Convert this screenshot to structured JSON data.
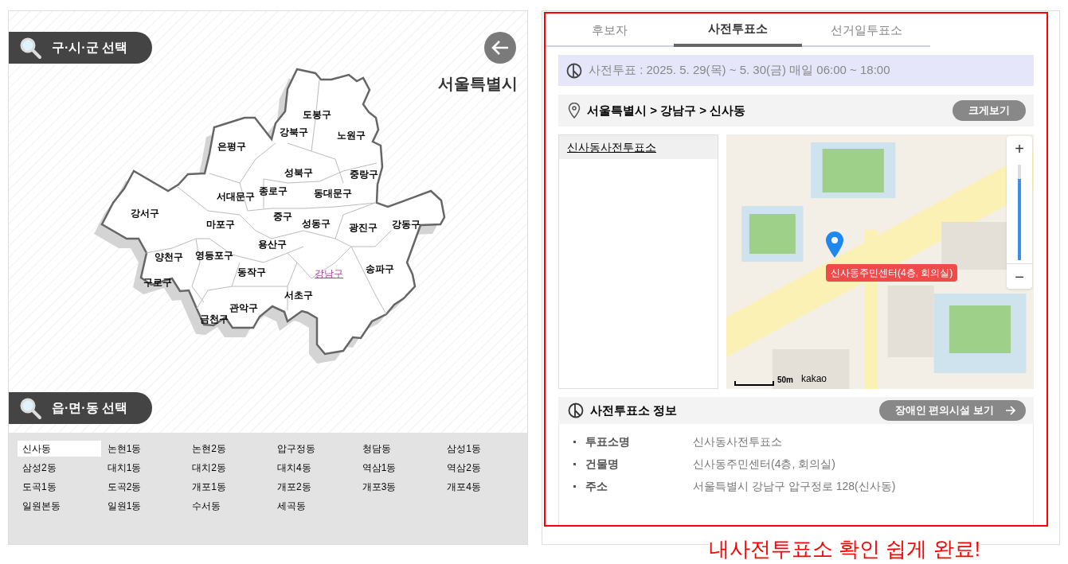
{
  "district_panel": {
    "header": "구·시·군 선택",
    "city": "서울특별시",
    "districts": [
      {
        "name": "도봉구",
        "selected": false
      },
      {
        "name": "강북구",
        "selected": false
      },
      {
        "name": "노원구",
        "selected": false
      },
      {
        "name": "은평구",
        "selected": false
      },
      {
        "name": "성북구",
        "selected": false
      },
      {
        "name": "중랑구",
        "selected": false
      },
      {
        "name": "종로구",
        "selected": false
      },
      {
        "name": "서대문구",
        "selected": false
      },
      {
        "name": "동대문구",
        "selected": false
      },
      {
        "name": "강서구",
        "selected": false
      },
      {
        "name": "마포구",
        "selected": false
      },
      {
        "name": "중구",
        "selected": false
      },
      {
        "name": "성동구",
        "selected": false
      },
      {
        "name": "광진구",
        "selected": false
      },
      {
        "name": "강동구",
        "selected": false
      },
      {
        "name": "용산구",
        "selected": false
      },
      {
        "name": "양천구",
        "selected": false
      },
      {
        "name": "영등포구",
        "selected": false
      },
      {
        "name": "동작구",
        "selected": false
      },
      {
        "name": "강남구",
        "selected": true
      },
      {
        "name": "송파구",
        "selected": false
      },
      {
        "name": "구로구",
        "selected": false
      },
      {
        "name": "서초구",
        "selected": false
      },
      {
        "name": "관악구",
        "selected": false
      },
      {
        "name": "금천구",
        "selected": false
      }
    ]
  },
  "dong_panel": {
    "header": "읍·면·동 선택",
    "dongs": [
      {
        "name": "신사동",
        "selected": true
      },
      {
        "name": "논현1동",
        "selected": false
      },
      {
        "name": "논현2동",
        "selected": false
      },
      {
        "name": "압구정동",
        "selected": false
      },
      {
        "name": "청담동",
        "selected": false
      },
      {
        "name": "삼성1동",
        "selected": false
      },
      {
        "name": "삼성2동",
        "selected": false
      },
      {
        "name": "대치1동",
        "selected": false
      },
      {
        "name": "대치2동",
        "selected": false
      },
      {
        "name": "대치4동",
        "selected": false
      },
      {
        "name": "역삼1동",
        "selected": false
      },
      {
        "name": "역삼2동",
        "selected": false
      },
      {
        "name": "도곡1동",
        "selected": false
      },
      {
        "name": "도곡2동",
        "selected": false
      },
      {
        "name": "개포1동",
        "selected": false
      },
      {
        "name": "개포2동",
        "selected": false
      },
      {
        "name": "개포3동",
        "selected": false
      },
      {
        "name": "개포4동",
        "selected": false
      },
      {
        "name": "일원본동",
        "selected": false
      },
      {
        "name": "일원1동",
        "selected": false
      },
      {
        "name": "수서동",
        "selected": false
      },
      {
        "name": "세곡동",
        "selected": false
      }
    ]
  },
  "tabs": [
    {
      "label": "후보자",
      "selected": false
    },
    {
      "label": "사전투표소",
      "selected": true
    },
    {
      "label": "선거일투표소",
      "selected": false
    }
  ],
  "notice": "사전투표 : 2025. 5. 29(목) ~ 5. 30(금) 매일 06:00 ~ 18:00",
  "location": {
    "path": "서울특별시 > 강남구 > 신사동",
    "button": "크게보기"
  },
  "stations": [
    {
      "name": "신사동사전투표소",
      "selected": true
    }
  ],
  "map": {
    "kind": "picture",
    "zoom_in": "+",
    "zoom_out": "−",
    "zoom_slider": {
      "level": 0.85
    },
    "marker_label": "신사동주민센터(4층, 회의실)",
    "scale": "50m",
    "logo": "kakao"
  },
  "info": {
    "title": "사전투표소 정보",
    "button": "장애인 편의시설 보기",
    "rows": [
      {
        "label": "투표소명",
        "value": "신사동사전투표소"
      },
      {
        "label": "건물명",
        "value": "신사동주민센터(4층, 회의실)"
      },
      {
        "label": "주소",
        "value": "서울특별시 강남구 압구정로 128(신사동)"
      }
    ]
  },
  "caption": "내사전투표소 확인 쉽게 완료!"
}
